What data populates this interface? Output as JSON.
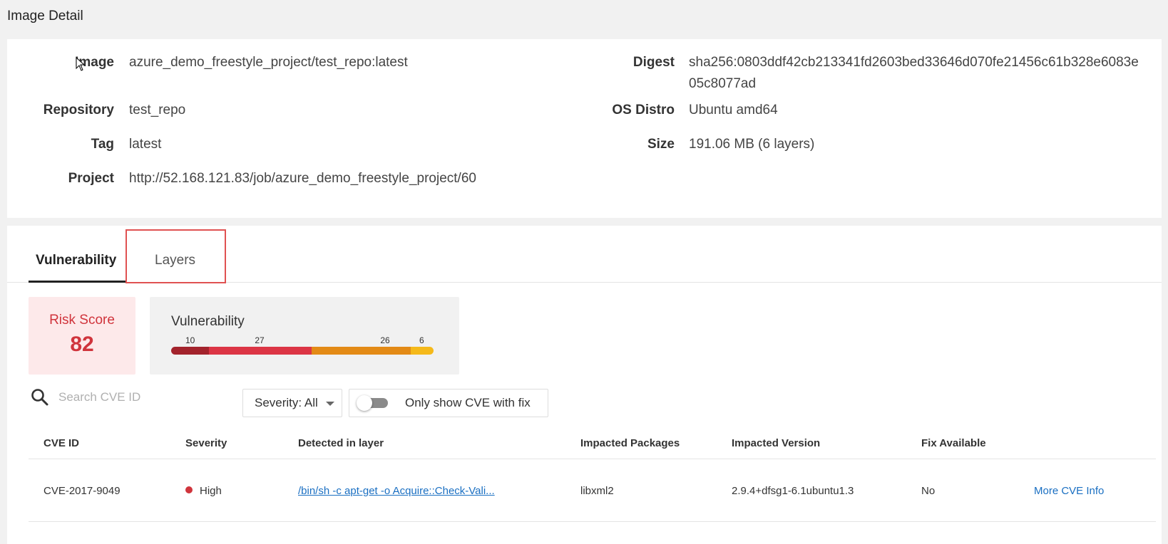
{
  "page": {
    "title": "Image Detail"
  },
  "details": {
    "left": [
      {
        "label": "Image",
        "value": "azure_demo_freestyle_project/test_repo:latest"
      },
      {
        "label": "Repository",
        "value": "test_repo"
      },
      {
        "label": "Tag",
        "value": "latest"
      },
      {
        "label": "Project",
        "value": "http://52.168.121.83/job/azure_demo_freestyle_project/60"
      }
    ],
    "right": [
      {
        "label": "Digest",
        "value": "sha256:0803ddf42cb213341fd2603bed33646d070fe21456c61b328e6083e05c8077ad"
      },
      {
        "label": "OS Distro",
        "value": "Ubuntu amd64"
      },
      {
        "label": "Size",
        "value": "191.06 MB (6 layers)"
      }
    ]
  },
  "tabs": [
    {
      "label": "Vulnerability",
      "active": true
    },
    {
      "label": "Layers",
      "active": false
    }
  ],
  "risk": {
    "label": "Risk Score",
    "value": "82"
  },
  "vulnerability_summary": {
    "title": "Vulnerability",
    "segments": [
      {
        "count": "10",
        "value": 10,
        "color": "#a3232c"
      },
      {
        "count": "27",
        "value": 27,
        "color": "#dc3545"
      },
      {
        "count": "26",
        "value": 26,
        "color": "#e38a16"
      },
      {
        "count": "6",
        "value": 6,
        "color": "#f5b91a"
      }
    ]
  },
  "filters": {
    "search_placeholder": "Search CVE ID",
    "severity_label": "Severity: All",
    "fix_toggle_label": "Only show CVE with fix",
    "fix_toggle_on": false
  },
  "table": {
    "headers": [
      "CVE ID",
      "Severity",
      "Detected in layer",
      "Impacted Packages",
      "Impacted Version",
      "Fix Available"
    ],
    "rows": [
      {
        "cve_id": "CVE-2017-9049",
        "severity": "High",
        "severity_color": "#d0343c",
        "layer": "/bin/sh -c apt-get -o Acquire::Check-Vali...",
        "package": "libxml2",
        "version": "2.9.4+dfsg1-6.1ubuntu1.3",
        "fix": "No",
        "more_info": "More CVE Info"
      }
    ]
  },
  "colors": {
    "accent_red": "#d0343c",
    "link_blue": "#1a6fc2",
    "highlight_border": "#e05252"
  }
}
